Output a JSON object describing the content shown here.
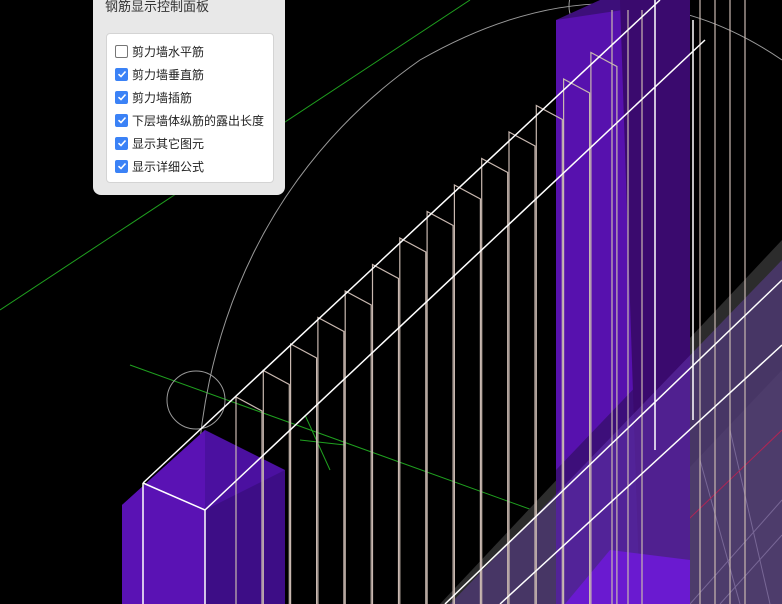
{
  "panel": {
    "title": "钢筋显示控制面板",
    "options": [
      {
        "label": "剪力墙水平筋",
        "checked": false
      },
      {
        "label": "剪力墙垂直筋",
        "checked": true
      },
      {
        "label": "剪力墙插筋",
        "checked": true
      },
      {
        "label": "下层墙体纵筋的露出长度",
        "checked": true
      },
      {
        "label": "显示其它图元",
        "checked": true
      },
      {
        "label": "显示详细公式",
        "checked": true
      }
    ]
  },
  "viewport": {
    "background": "#000000",
    "column_color": "#5a12b4",
    "wall_outline_color": "#ffffff",
    "rebar_color": "#c9b8b0",
    "axis_color": "#1fa01f",
    "red_axis_color": "#cc1111",
    "orbit_circle_color": "#9a9a9a",
    "slab_color": "#3a3a3a"
  }
}
